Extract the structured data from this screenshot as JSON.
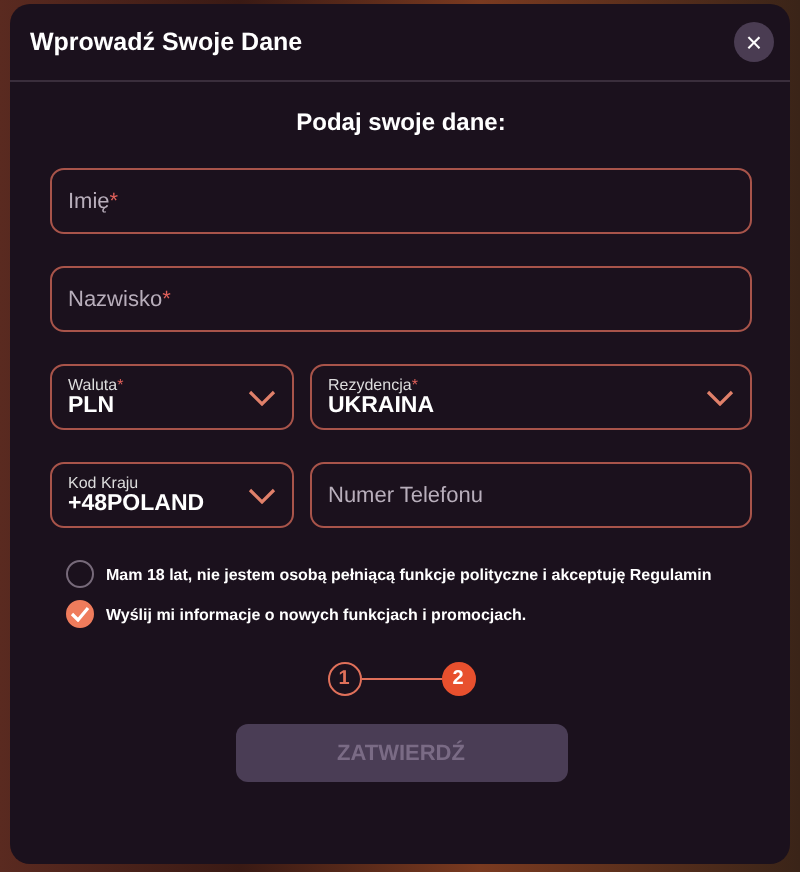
{
  "dialog": {
    "title": "Wprowadź Swoje Dane",
    "close": "×"
  },
  "heading": "Podaj swoje dane:",
  "rows": [
    [
      {
        "kind": "text",
        "placeholder": "Imię",
        "mark": "*"
      }
    ],
    [
      {
        "kind": "text",
        "placeholder": "Nazwisko",
        "mark": "*"
      }
    ],
    [
      {
        "kind": "select",
        "label": "Waluta",
        "mark": "*",
        "value": "PLN"
      },
      {
        "kind": "select",
        "label": "Rezydencja",
        "mark": "*",
        "value": "UKRAINA"
      }
    ],
    [
      {
        "kind": "select",
        "label": "Kod Kraju",
        "value": "+48POLAND"
      },
      {
        "kind": "text",
        "placeholder": "Numer Telefonu"
      }
    ]
  ],
  "checkboxes": [
    {
      "label": "Mam 18 lat, nie jestem osobą pełniącą funkcje polityczne i akceptuję Regulamin",
      "checked": false
    },
    {
      "label": "Wyślij mi informacje o nowych funkcjach i promocjach.",
      "checked": true
    }
  ],
  "steps": [
    {
      "label": "1",
      "selected": false
    },
    {
      "label": "2",
      "selected": true
    }
  ],
  "submit": {
    "label": "ZATWIERDŹ",
    "disabled": true
  }
}
